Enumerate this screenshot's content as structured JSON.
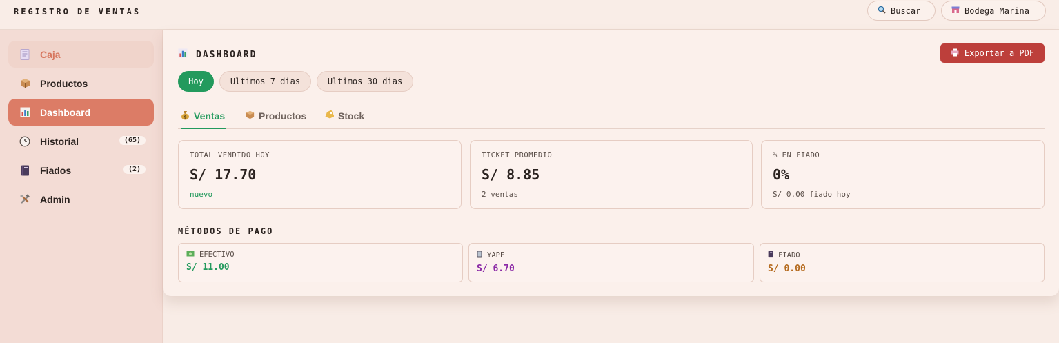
{
  "header": {
    "app_title": "REGISTRO DE VENTAS",
    "search_label": "Buscar",
    "store_label": "Bodega Marina"
  },
  "sidebar": {
    "items": [
      {
        "label": "Caja",
        "icon": "receipt-icon",
        "state": "soft"
      },
      {
        "label": "Productos",
        "icon": "package-icon"
      },
      {
        "label": "Dashboard",
        "icon": "bar-chart-icon",
        "state": "active"
      },
      {
        "label": "Historial",
        "icon": "clock-icon",
        "count": "(65)"
      },
      {
        "label": "Fiados",
        "icon": "notebook-icon",
        "count": "(2)"
      },
      {
        "label": "Admin",
        "icon": "tools-icon"
      }
    ]
  },
  "main": {
    "title": "DASHBOARD",
    "export_label": "Exportar a PDF",
    "ranges": [
      "Hoy",
      "Ultimos 7 dias",
      "Ultimos 30 dias"
    ],
    "active_range": "Hoy",
    "tabs": [
      {
        "label": "Ventas",
        "icon": "money-bag-icon"
      },
      {
        "label": "Productos",
        "icon": "package-icon"
      },
      {
        "label": "Stock",
        "icon": "tag-icon"
      }
    ],
    "active_tab": "Ventas",
    "kpis": [
      {
        "label": "TOTAL VENDIDO HOY",
        "value": "S/ 17.70",
        "sub": "nuevo"
      },
      {
        "label": "TICKET PROMEDIO",
        "value": "S/ 8.85",
        "sub": "2 ventas"
      },
      {
        "label": "% EN FIADO",
        "value": "0%",
        "sub": "S/ 0.00 fiado hoy"
      }
    ],
    "payments_title": "MÉTODOS DE PAGO",
    "payments": [
      {
        "label": "EFECTIVO",
        "value": "S/ 11.00",
        "icon": "cash-icon",
        "color": "#239a5d"
      },
      {
        "label": "YAPE",
        "value": "S/ 6.70",
        "icon": "phone-icon",
        "color": "#8b2aa6"
      },
      {
        "label": "FIADO",
        "value": "S/ 0.00",
        "icon": "notebook-icon",
        "color": "#b56b1f"
      }
    ]
  },
  "colors": {
    "accent": "#dc7c66",
    "success": "#239a5d",
    "danger": "#bd3f3b"
  }
}
